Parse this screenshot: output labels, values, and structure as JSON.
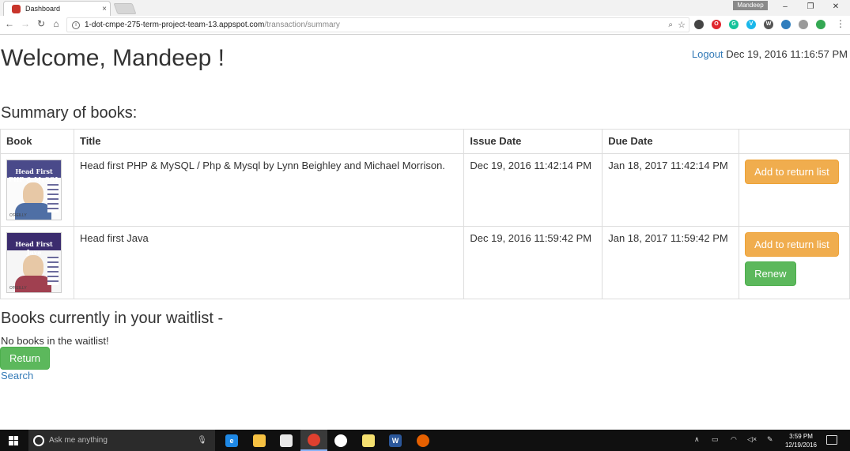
{
  "browser": {
    "tab_title": "Dashboard",
    "tab_close": "×",
    "profile": "Mandeep",
    "window_controls": [
      "–",
      "❐",
      "✕"
    ],
    "url_host": "1-dot-cmpe-275-term-project-team-13.appspot.com",
    "url_path": "/transaction/summary",
    "info_icon": "i",
    "extensions": [
      {
        "name": "extension-icon-1",
        "label": "",
        "color": "#444444"
      },
      {
        "name": "opera-icon",
        "label": "O",
        "color": "#e0262e"
      },
      {
        "name": "grammarly-icon",
        "label": "G",
        "color": "#15c39a"
      },
      {
        "name": "vimeo-icon",
        "label": "V",
        "color": "#1ab7ea"
      },
      {
        "name": "w-extension-icon",
        "label": "W",
        "color": "#555555"
      },
      {
        "name": "extension-icon-6",
        "label": "",
        "color": "#2e7dbd"
      },
      {
        "name": "extension-icon-7",
        "label": "",
        "color": "#9a9a9a"
      },
      {
        "name": "extension-icon-8",
        "label": "",
        "color": "#34a853"
      }
    ]
  },
  "header": {
    "welcome": "Welcome, Mandeep !",
    "logout": "Logout",
    "datetime": "Dec 19, 2016 11:16:57 PM"
  },
  "summary": {
    "heading": "Summary of books:",
    "columns": [
      "Book",
      "Title",
      "Issue Date",
      "Due Date",
      ""
    ],
    "rows": [
      {
        "cover_text": "Head First PHP & MySQL",
        "cover_brand": "O'REILLY",
        "title": "Head first PHP & MySQL / Php & Mysql by Lynn Beighley and Michael Morrison.",
        "issue_date": "Dec 19, 2016 11:42:14 PM",
        "due_date": "Jan 18, 2017 11:42:14 PM",
        "return_label": "Add to return list"
      },
      {
        "cover_text": "Head First Java",
        "cover_brand": "O'REILLY",
        "title": "Head first Java",
        "issue_date": "Dec 19, 2016 11:59:42 PM",
        "due_date": "Jan 18, 2017 11:59:42 PM",
        "return_label": "Add to return list",
        "renew_label": "Renew"
      }
    ]
  },
  "waitlist": {
    "heading": "Books currently in your waitlist -",
    "empty_text": "No books in the waitlist!",
    "return_label": "Return",
    "search_label": "Search"
  },
  "taskbar": {
    "search_placeholder": "Ask me anything",
    "apps": [
      {
        "name": "edge-icon",
        "label": "e",
        "color": "#1e88e5"
      },
      {
        "name": "file-explorer-icon",
        "label": "",
        "color": "#f6c142"
      },
      {
        "name": "store-icon",
        "label": "",
        "color": "#e8e8e8"
      },
      {
        "name": "chrome-icon",
        "label": "",
        "color": "#e0402f"
      },
      {
        "name": "slack-icon",
        "label": "",
        "color": "#ffffff"
      },
      {
        "name": "sticky-notes-icon",
        "label": "",
        "color": "#f5e070"
      },
      {
        "name": "word-icon",
        "label": "W",
        "color": "#2b579a"
      },
      {
        "name": "firefox-icon",
        "label": "",
        "color": "#e66000"
      }
    ],
    "time": "3:59 PM",
    "date": "12/19/2016"
  }
}
